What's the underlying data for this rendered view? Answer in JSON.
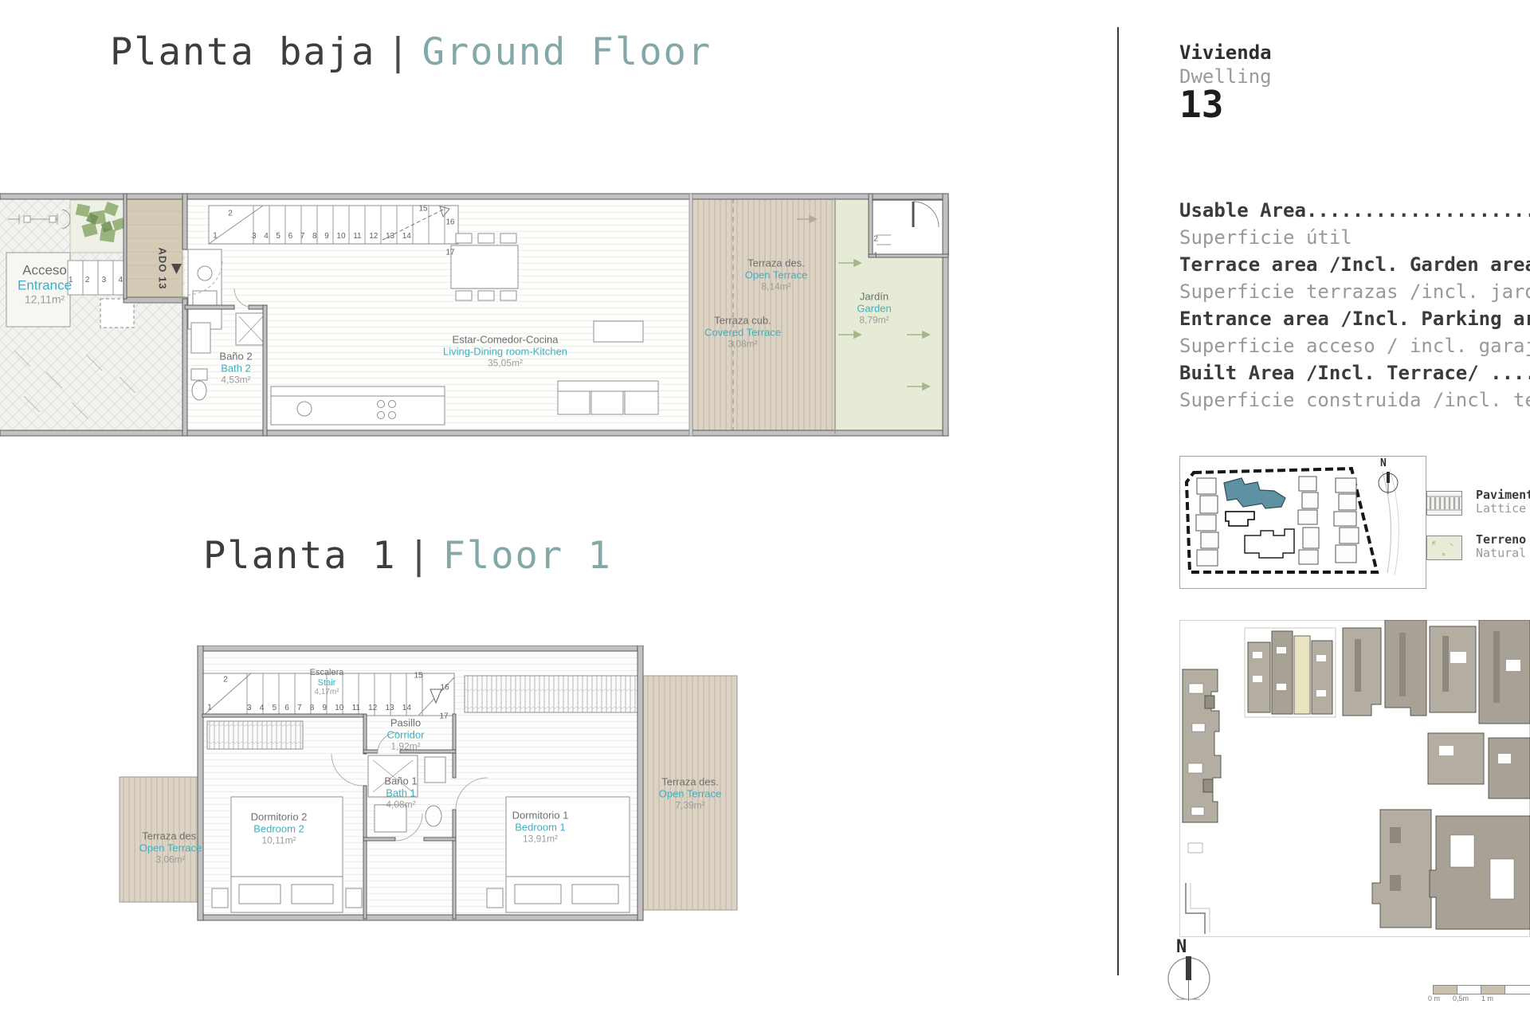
{
  "colors": {
    "label_teal": "#3fafc0",
    "title_teal": "#84a7a7",
    "terrace_beige": "#ddd4c5",
    "garden_green": "#e6ebd6",
    "site_highlight_teal": "#5e92a2"
  },
  "ground": {
    "title_es": "Planta baja",
    "sep": "|",
    "title_en": "Ground Floor",
    "ado_label": "ADO 13",
    "entry_treads": [
      "1",
      "2",
      "3",
      "4"
    ],
    "stair": {
      "n2": "2",
      "n1": "1",
      "run": [
        "3",
        "4",
        "5",
        "6",
        "7",
        "8",
        "9",
        "10",
        "11",
        "12",
        "13",
        "14"
      ],
      "n15": "15",
      "n16": "16",
      "n17": "17"
    },
    "corner_steps": {
      "n2": "2",
      "n1": "1"
    },
    "rooms": {
      "acceso": {
        "es": "Acceso",
        "en": "Entrance",
        "area": "12,11m²"
      },
      "bath2": {
        "es": "Baño 2",
        "en": "Bath 2",
        "area": "4,53m²"
      },
      "living": {
        "es": "Estar-Comedor-Cocina",
        "en": "Living-Dining room-Kitchen",
        "area": "35,05m²"
      },
      "terrace_open": {
        "es": "Terraza des.",
        "en": "Open Terrace",
        "area": "8,14m²"
      },
      "terrace_cov": {
        "es": "Terraza cub.",
        "en": "Covered Terrace",
        "area": "3,08m²"
      },
      "garden": {
        "es": "Jardín",
        "en": "Garden",
        "area": "8,79m²"
      }
    }
  },
  "floor1": {
    "title_es": "Planta 1",
    "sep": "|",
    "title_en": "Floor 1",
    "stair": {
      "n2": "2",
      "n1": "1",
      "run": [
        "3",
        "4",
        "5",
        "6",
        "7",
        "8",
        "9",
        "10",
        "11",
        "12",
        "13",
        "14"
      ],
      "n15": "15",
      "n16": "16",
      "n17": "17"
    },
    "rooms": {
      "escalera": {
        "es": "Escalera",
        "en": "Stair",
        "area": "4,17m²"
      },
      "corridor": {
        "es": "Pasillo",
        "en": "Corridor",
        "area": "1,92m²"
      },
      "bath1": {
        "es": "Baño 1",
        "en": "Bath 1",
        "area": "4,08m²"
      },
      "bed2": {
        "es": "Dormitorio 2",
        "en": "Bedroom 2",
        "area": "10,11m²"
      },
      "bed1": {
        "es": "Dormitorio 1",
        "en": "Bedroom 1",
        "area": "13,91m²"
      },
      "terrace_left": {
        "es": "Terraza des.",
        "en": "Open Terrace",
        "area": "3,06m²"
      },
      "terrace_right": {
        "es": "Terraza des.",
        "en": "Open Terrace",
        "area": "7,39m²"
      }
    }
  },
  "panel": {
    "dwelling_es": "Vivienda",
    "dwelling_en": "Dwelling",
    "dwelling_no": "13",
    "specs": [
      {
        "en": "Usable Area..........................",
        "es": "Superficie útil"
      },
      {
        "en": "Terrace area /Incl. Garden area/.....",
        "es": "Superficie terrazas /incl. jardín/"
      },
      {
        "en": "Entrance area /Incl. Parking area/...",
        "es": "Superficie acceso / incl. garaje/"
      },
      {
        "en": "Built Area /Incl. Terrace/ ..........",
        "es": "Superficie construida /incl. terraza/"
      }
    ],
    "legend": [
      {
        "es": "Pavimento",
        "en": "Lattice"
      },
      {
        "es": "Terreno",
        "en": "Natural"
      }
    ],
    "compass_n": "N",
    "scale_ticks": [
      "0 m",
      "0,5m",
      "1 m"
    ]
  }
}
